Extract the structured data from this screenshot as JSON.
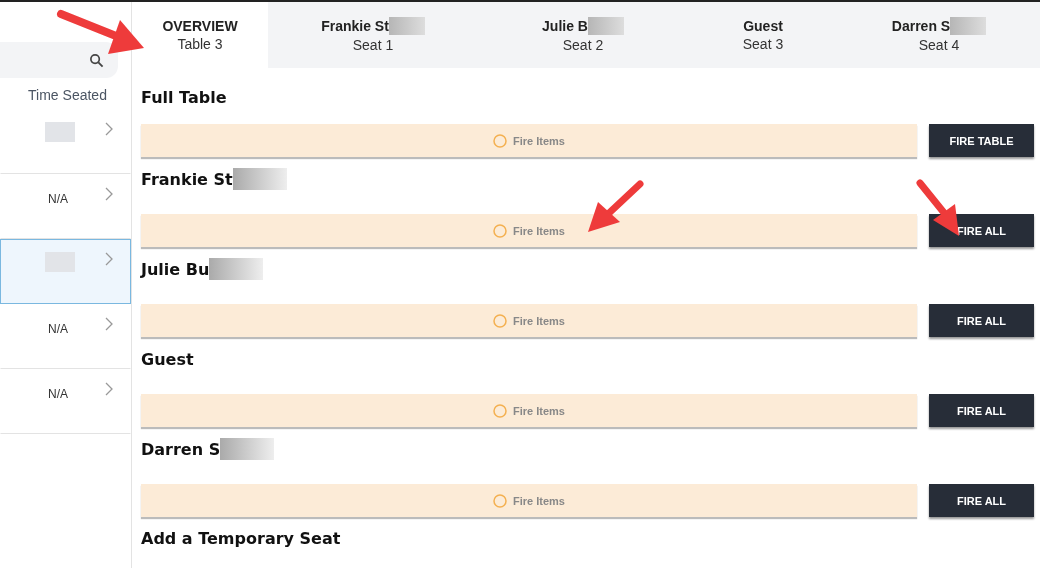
{
  "tabs": [
    {
      "title": "OVERVIEW",
      "subtitle": "Table 3",
      "selected": true,
      "redacted": false
    },
    {
      "title": "Frankie St",
      "subtitle": "Seat 1",
      "selected": false,
      "redacted": true
    },
    {
      "title": "Julie B",
      "subtitle": "Seat 2",
      "selected": false,
      "redacted": true
    },
    {
      "title": "Guest",
      "subtitle": "Seat 3",
      "selected": false,
      "redacted": false
    },
    {
      "title": "Darren S",
      "subtitle": "Seat 4",
      "selected": false,
      "redacted": true
    }
  ],
  "sidebar": {
    "column_header": "Time Seated",
    "rows": [
      {
        "kind": "redacted",
        "selected": false
      },
      {
        "kind": "text",
        "time": "N/A",
        "selected": false
      },
      {
        "kind": "redacted",
        "selected": true
      },
      {
        "kind": "text",
        "time": "N/A",
        "selected": false
      },
      {
        "kind": "text",
        "time": "N/A",
        "selected": false
      }
    ]
  },
  "sections": [
    {
      "heading": "Full Table",
      "redacted": false,
      "status": "Fire Items",
      "button": "FIRE TABLE"
    },
    {
      "heading": "Frankie St",
      "redacted": true,
      "status": "Fire Items",
      "button": "FIRE ALL"
    },
    {
      "heading": "Julie Bu",
      "redacted": true,
      "status": "Fire Items",
      "button": "FIRE ALL"
    },
    {
      "heading": "Guest",
      "redacted": false,
      "status": "Fire Items",
      "button": "FIRE ALL"
    },
    {
      "heading": "Darren S",
      "redacted": true,
      "status": "Fire Items",
      "button": "FIRE ALL"
    }
  ],
  "footer_heading": "Add a Temporary Seat"
}
